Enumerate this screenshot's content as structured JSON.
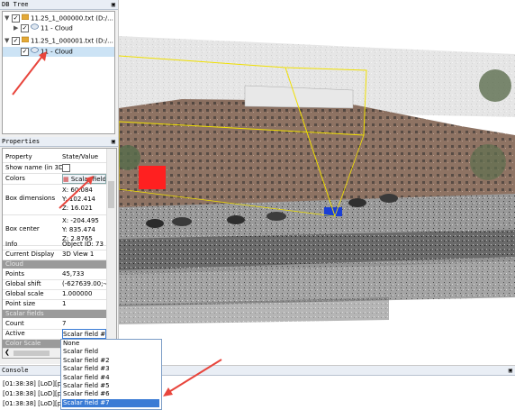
{
  "db_tree": {
    "title": "DB Tree",
    "items": [
      {
        "label": "11.25_1_000000.txt (D:/...",
        "type": "file",
        "checked": true,
        "expanded": true
      },
      {
        "label": "11 - Cloud",
        "type": "cloud",
        "checked": true,
        "expanded": false
      },
      {
        "label": "11.25_1_000001.txt (D:/...",
        "type": "file",
        "checked": true,
        "expanded": true
      },
      {
        "label": "11 - Cloud",
        "type": "cloud",
        "checked": true,
        "selected": true
      }
    ]
  },
  "properties": {
    "title": "Properties",
    "header": {
      "key": "Property",
      "value": "State/Value"
    },
    "rows": [
      {
        "key": "Show name (in 3D)",
        "value": ""
      },
      {
        "key": "Colors",
        "value": "Scalar field"
      },
      {
        "key": "Box dimensions",
        "value_lines": [
          "X: 60.084",
          "Y: 102.414",
          "Z: 16.021"
        ]
      },
      {
        "key": "Box center",
        "value_lines": [
          "X: -204.495",
          "Y: 835.474",
          "Z: 2.8765"
        ]
      },
      {
        "key": "Info",
        "value": "Object ID: 73"
      },
      {
        "key": "Current Display",
        "value": "3D View 1"
      }
    ],
    "cloud_section": "Cloud",
    "cloud_rows": [
      {
        "key": "Points",
        "value": "45,733"
      },
      {
        "key": "Global shift",
        "value": "(-627639.00;-4"
      },
      {
        "key": "Global scale",
        "value": "1.000000"
      },
      {
        "key": "Point size",
        "value": "1"
      }
    ],
    "scalar_section": "Scalar fields",
    "scalar_rows": [
      {
        "key": "Count",
        "value": "7"
      },
      {
        "key": "Active",
        "value": "Scalar field #7"
      }
    ],
    "color_scale_section": "Color Scale"
  },
  "dropdown": {
    "options": [
      "None",
      "Scalar field",
      "Scalar field #2",
      "Scalar field #3",
      "Scalar field #4",
      "Scalar field #5",
      "Scalar field #6",
      "Scalar field #7"
    ],
    "selected": "Scalar field #7"
  },
  "console": {
    "title": "Console",
    "lines": [
      "[01:38:38] [LoD][pa",
      "[01:38:38] [LoD][pa",
      "[01:38:38] [LoD][pa"
    ]
  },
  "colors": {
    "annotation_arrow": "#e8453c",
    "selection": "#3a7bd5"
  }
}
